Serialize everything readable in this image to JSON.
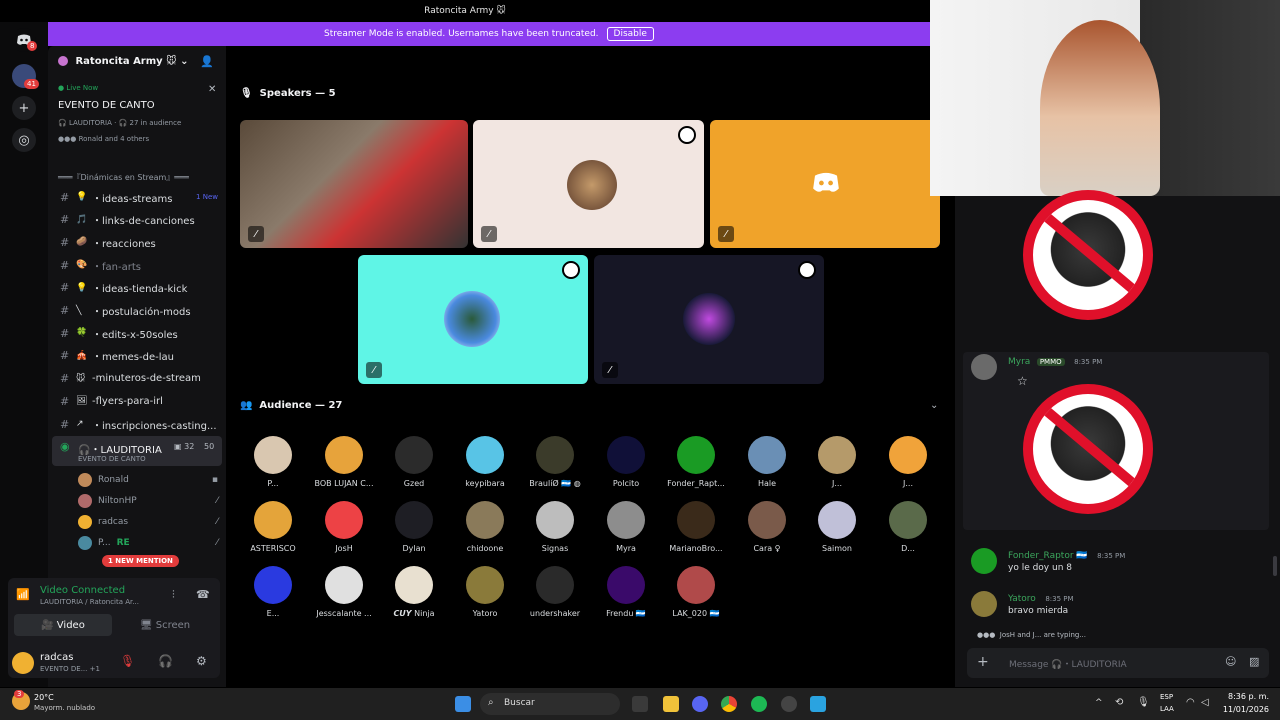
{
  "window": {
    "title": "Ratoncita Army 🐭"
  },
  "banner": {
    "text": "Streamer Mode is enabled. Usernames have been truncated.",
    "button": "Disable"
  },
  "rail": {
    "badge_top": "8",
    "badge_server": "41"
  },
  "server": {
    "name": "Ratoncita Army 🐭"
  },
  "live": {
    "status": "Live Now",
    "event": "EVENTO DE CANTO",
    "meta": "LAUDITORIA · 🎧 27 in audience",
    "others": "Ronald and 4 others"
  },
  "category": "═══『Dinámicas en Stream』═══",
  "channels": [
    {
      "icon": "💡",
      "label": "・ideas-streams",
      "badge": "1 New"
    },
    {
      "icon": "🎵",
      "label": "・links-de-canciones"
    },
    {
      "icon": "🥔",
      "label": "・reacciones"
    },
    {
      "icon": "🎨",
      "label": "・fan-arts"
    },
    {
      "icon": "💡",
      "label": "・ideas-tienda-kick"
    },
    {
      "icon": "╲",
      "label": "・postulación-mods"
    },
    {
      "icon": "🍀",
      "label": "・edits-x-50soles"
    },
    {
      "icon": "🎪",
      "label": "・memes-de-lau"
    },
    {
      "icon": "🐭",
      "label": "-minuteros-de-stream"
    },
    {
      "icon": "🖼",
      "label": "-flyers-para-irl"
    },
    {
      "icon": "↗",
      "label": "・inscripciones-casting..."
    }
  ],
  "stage_channel": {
    "label": "🎧・LAUDITORIA",
    "count1": "32",
    "count2": "50",
    "sub": "EVENTO DE CANTO"
  },
  "voice_users": [
    {
      "name": "Ronald"
    },
    {
      "name": "NiltonHP"
    },
    {
      "name": "radcas"
    },
    {
      "name": "P...",
      "tag": "RE"
    }
  ],
  "mention_pill": "1 NEW MENTION",
  "voice_panel": {
    "status": "Video Connected",
    "location": "LAUDITORIA / Ratoncita Ar...",
    "video_label": "Video",
    "screen_label": "Screen"
  },
  "self_user": {
    "name": "radcas",
    "status": "EVENTO DE...",
    "extra": "+1"
  },
  "speakers_header": "Speakers — 5",
  "audience_header": "Audience — 27",
  "audience": [
    {
      "name": "P...",
      "color": "#d9c7b0"
    },
    {
      "name": "BOB LUJAN C...",
      "color": "#e7a33b"
    },
    {
      "name": "Gzed",
      "color": "#2b2b2b"
    },
    {
      "name": "keypibara",
      "color": "#58c4e6"
    },
    {
      "name": "BraulíØ 🇭🇳 ◍",
      "color": "#3b3b2a"
    },
    {
      "name": "Polcito",
      "color": "#101038"
    },
    {
      "name": "Fonder_Rapt...",
      "color": "#1a9b24"
    },
    {
      "name": "Hale",
      "color": "#6a8fb5"
    },
    {
      "name": "J...",
      "color": "#b59a6a"
    },
    {
      "name": "J...",
      "color": "#f0a33a"
    },
    {
      "name": "ASTERISCO",
      "color": "#e4a43a"
    },
    {
      "name": "JosH",
      "color": "#ed4245"
    },
    {
      "name": "Dylan",
      "color": "#1e1e24"
    },
    {
      "name": "chidoone",
      "color": "#8a7a5a"
    },
    {
      "name": "Signas",
      "color": "#bdbdbd"
    },
    {
      "name": "Myra",
      "color": "#8d8d8d"
    },
    {
      "name": "MarianoBro...",
      "color": "#3a2a1a"
    },
    {
      "name": "Cara ♀",
      "color": "#7a5a4a"
    },
    {
      "name": "Saimon",
      "color": "#c0c0d8"
    },
    {
      "name": "D...",
      "color": "#5a6a4a"
    },
    {
      "name": "E...",
      "color": "#2a3ae0"
    },
    {
      "name": "Jesscalante ...",
      "color": "#e0e0e0"
    },
    {
      "name": "𝘾𝙐𝙔 Ninja",
      "color": "#e8e0d0"
    },
    {
      "name": "Yatoro",
      "color": "#8a7a3a"
    },
    {
      "name": "undershaker",
      "color": "#2a2a2a"
    },
    {
      "name": "Frendu 🇭🇳",
      "color": "#3a0a6a"
    },
    {
      "name": "LAK_020 🇭🇳",
      "color": "#b04a4a"
    }
  ],
  "chat": {
    "messages": [
      {
        "author": "Myra",
        "tag": "PMMO",
        "time": "8:35 PM",
        "color": "#3ba55c",
        "text": ""
      },
      {
        "author": "Fonder_Raptor 🇭🇳",
        "time": "8:35 PM",
        "color": "#3ba55c",
        "text": "yo le doy un 8"
      },
      {
        "author": "Yatoro",
        "time": "8:35 PM",
        "color": "#3ba55c",
        "text": "bravo mierda"
      }
    ],
    "typing": "JosH and J... are typing...",
    "placeholder": "Message 🎧・LAUDITORIA"
  },
  "taskbar": {
    "weather_temp": "20°C",
    "weather_desc": "Mayorm. nublado",
    "weather_badge": "3",
    "search": "Buscar",
    "lang1": "ESP",
    "lang2": "LAA",
    "time": "8:36 p. m.",
    "date": "11/01/2026"
  }
}
